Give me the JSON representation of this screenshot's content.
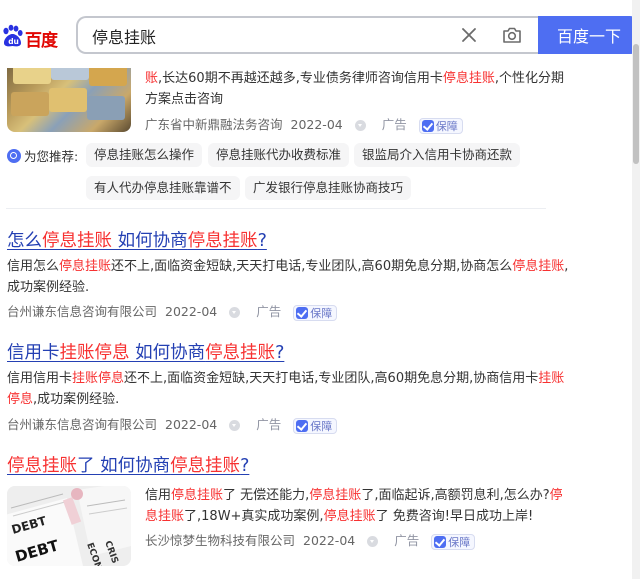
{
  "header": {
    "logo_text": "百度",
    "query": "停息挂账",
    "search_button": "百度一下"
  },
  "result0": {
    "desc": [
      {
        "t": "账",
        "h": true
      },
      {
        "t": ",长达60期不再越还越多,专业债务律师咨询信用卡",
        "h": false
      },
      {
        "t": "停息挂账",
        "h": true
      },
      {
        "t": ",个性化分期",
        "h": false
      }
    ],
    "desc_line2": "方案点击咨询",
    "source": "广东省中新鼎融法务咨询",
    "date": "2022-04",
    "ad": "广告",
    "guard": "保障"
  },
  "recommend": {
    "label": "为您推荐:",
    "items": [
      "停息挂账怎么操作",
      "停息挂账代办收费标准",
      "银监局介入信用卡协商还款",
      "有人代办停息挂账靠谱不",
      "广发银行停息挂账协商技巧"
    ]
  },
  "result1": {
    "title": [
      {
        "t": "怎么",
        "h": false
      },
      {
        "t": "停息挂账",
        "h": true
      },
      {
        "t": " 如何协商",
        "h": false
      },
      {
        "t": "停息挂账",
        "h": true
      },
      {
        "t": "?",
        "h": false
      }
    ],
    "desc_line1": [
      {
        "t": "信用怎么",
        "h": false
      },
      {
        "t": "停息挂账",
        "h": true
      },
      {
        "t": "还不上,面临资金短缺,天天打电话,专业团队,高60期免息分期,协商怎么",
        "h": false
      },
      {
        "t": "停息挂账",
        "h": true
      },
      {
        "t": ",",
        "h": false
      }
    ],
    "desc_line2": "成功案例经验.",
    "source": "台州谦东信息咨询有限公司",
    "date": "2022-04",
    "ad": "广告",
    "guard": "保障"
  },
  "result2": {
    "title": [
      {
        "t": "信用卡",
        "h": false
      },
      {
        "t": "挂账停息",
        "h": true
      },
      {
        "t": " 如何协商",
        "h": false
      },
      {
        "t": "停息挂账",
        "h": true
      },
      {
        "t": "?",
        "h": false
      }
    ],
    "desc_line1": [
      {
        "t": "信用信用卡",
        "h": false
      },
      {
        "t": "挂账停息",
        "h": true
      },
      {
        "t": "还不上,面临资金短缺,天天打电话,专业团队,高60期免息分期,协商信用卡",
        "h": false
      },
      {
        "t": "挂账",
        "h": true
      }
    ],
    "desc_line2": [
      {
        "t": "停息",
        "h": true
      },
      {
        "t": ",成功案例经验.",
        "h": false
      }
    ],
    "source": "台州谦东信息咨询有限公司",
    "date": "2022-04",
    "ad": "广告",
    "guard": "保障"
  },
  "result3": {
    "title": [
      {
        "t": "停息挂账",
        "h": true
      },
      {
        "t": "了 如何协商",
        "h": false
      },
      {
        "t": "停息挂账",
        "h": true
      },
      {
        "t": "?",
        "h": false
      }
    ],
    "desc_line1": [
      {
        "t": "信用",
        "h": false
      },
      {
        "t": "停息挂账",
        "h": true
      },
      {
        "t": "了 无偿还能力,",
        "h": false
      },
      {
        "t": "停息挂账",
        "h": true
      },
      {
        "t": "了,面临起诉,高额罚息利,怎么办?",
        "h": false
      },
      {
        "t": "停",
        "h": true
      }
    ],
    "desc_line2": [
      {
        "t": "息挂账",
        "h": true
      },
      {
        "t": "了,18W+真实成功案例,",
        "h": false
      },
      {
        "t": "停息挂账",
        "h": true
      },
      {
        "t": "了 免费咨询!早日成功上岸!",
        "h": false
      }
    ],
    "source": "长沙惊梦生物科技有限公司",
    "date": "2022-04",
    "ad": "广告",
    "guard": "保障",
    "thumb_text": [
      "DEBT",
      "DEBT",
      "ECONO",
      "CRIS"
    ]
  },
  "colors": {
    "link": "#2440b3",
    "highlight": "#f73131",
    "brand": "#4e6ef2",
    "logo_red": "#e10602"
  }
}
